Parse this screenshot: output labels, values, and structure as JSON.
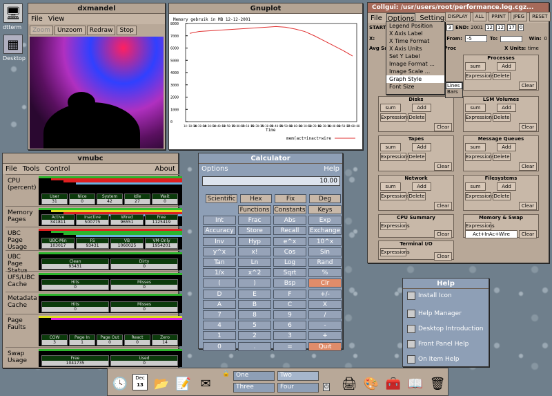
{
  "desktop": {
    "icon1": "dtterm",
    "icon2": "Desktop"
  },
  "dxmandel": {
    "title": "dxmandel",
    "menu": [
      "File",
      "View"
    ],
    "buttons": [
      "Zoom",
      "Unzoom",
      "Redraw",
      "Stop"
    ]
  },
  "gnuplot": {
    "title": "Gnuplot",
    "plot_title": "Memory gebruik in MB 12-12-2001",
    "xlabel": "Time",
    "legend": "mem(act+inact+wire"
  },
  "chart_data": {
    "type": "line",
    "title": "Memory gebruik in MB 12-12-2001",
    "xlabel": "Time",
    "ylabel": "",
    "ylim": [
      0,
      8000
    ],
    "yticks": [
      "0",
      "1000",
      "2000",
      "3000",
      "4000",
      "5000",
      "6000",
      "7000",
      "8000"
    ],
    "categories": [
      "14:10:00",
      "14:20:00",
      "14:30:00",
      "14:40:00",
      "14:50:00",
      "15:00:00",
      "15:10:00",
      "15:20:00",
      "15:30:00",
      "15:40:00",
      "15:50:00",
      "16:00:00",
      "16:10:00",
      "16:20:00",
      "16:30:00",
      "16:40:00",
      "16:50:00",
      "17:00:00"
    ],
    "series": [
      {
        "name": "mem(act+inact+wire",
        "values": [
          7200,
          7350,
          7400,
          7450,
          7500,
          7550,
          7600,
          7650,
          7700,
          7750,
          7700,
          7550,
          7350,
          7000,
          6600,
          6200,
          5800,
          5350
        ]
      }
    ]
  },
  "vmubc": {
    "title": "vmubc",
    "menu": [
      "File",
      "Tools",
      "Control"
    ],
    "about": "About",
    "rows": [
      {
        "label": "CPU (percent)",
        "boxes": [
          [
            "User",
            "31"
          ],
          [
            "Nice",
            "0"
          ],
          [
            "System",
            "42"
          ],
          [
            "Idle",
            "27"
          ],
          [
            "Wait",
            "0"
          ]
        ]
      },
      {
        "label": "Memory Pages",
        "boxes": [
          [
            "Active",
            "341811"
          ],
          [
            "Inactive",
            "500775"
          ],
          [
            "Wired",
            "96551"
          ],
          [
            "Free",
            "1125419"
          ]
        ]
      },
      {
        "label": "UBC Page Usage",
        "boxes": [
          [
            "UBC-Min",
            "103017"
          ],
          [
            "FS",
            "93431"
          ],
          [
            "VB",
            "1060025"
          ],
          [
            "VM-Only",
            "1954201"
          ]
        ]
      },
      {
        "label": "UBC Page Status",
        "boxes": [
          [
            "Clean",
            "93431"
          ],
          [
            "Dirty",
            "0"
          ]
        ]
      },
      {
        "label": "UFS/UBC Cache",
        "boxes": [
          [
            "Hits",
            "0"
          ],
          [
            "Misses",
            "0"
          ]
        ]
      },
      {
        "label": "Metadata Cache",
        "boxes": [
          [
            "Hits",
            "0"
          ],
          [
            "Misses",
            "0"
          ]
        ]
      },
      {
        "label": "Page Faults",
        "boxes": [
          [
            "COW",
            "3"
          ],
          [
            "Page In",
            "1"
          ],
          [
            "Page Out",
            "0"
          ],
          [
            "React",
            "0"
          ],
          [
            "Zero",
            "14"
          ]
        ]
      },
      {
        "label": "Swap Usage",
        "boxes": [
          [
            "Free",
            "1041735"
          ],
          [
            "Used",
            "0"
          ]
        ]
      }
    ]
  },
  "calculator": {
    "title": "Calculator",
    "menu_left": "Options",
    "menu_right": "Help",
    "display": "10.00",
    "modes": [
      "Scientific",
      "Hex",
      "Fix",
      "Deg"
    ],
    "keys": [
      [
        "",
        "Functions",
        "Constants",
        "Keys"
      ],
      [
        "Int",
        "Frac",
        "Abs",
        "Exp"
      ],
      [
        "Accuracy",
        "Store",
        "Recall",
        "Exchange"
      ],
      [
        "Inv",
        "Hyp",
        "e^x",
        "10^x"
      ],
      [
        "y^x",
        "x!",
        "Cos",
        "Sin"
      ],
      [
        "Tan",
        "Ln",
        "Log",
        "Rand"
      ],
      [
        "1/x",
        "x^2",
        "Sqrt",
        "%"
      ],
      [
        "(",
        ")",
        "Bsp",
        "Clr"
      ],
      [
        "D",
        "E",
        "F",
        "+/-"
      ],
      [
        "A",
        "B",
        "C",
        "X"
      ],
      [
        "7",
        "8",
        "9",
        "/"
      ],
      [
        "4",
        "5",
        "6",
        "-"
      ],
      [
        "1",
        "2",
        "3",
        "+"
      ],
      [
        "0",
        ".",
        "=",
        "Quit"
      ]
    ]
  },
  "collgui": {
    "title": "Collgui: /usr/users/root/performance.log.cgz...",
    "menu": [
      "File",
      "Options",
      "Settings"
    ],
    "top_buttons": [
      "DISPLAY",
      "ALL",
      "PRINT",
      "JPEG",
      "RESET"
    ],
    "start_label": "START",
    "start_val": "3",
    "end_label": "END:",
    "end_vals": [
      "2001",
      "12",
      "12",
      "17",
      "0"
    ],
    "x_label": "X:",
    "from_label": "From:",
    "from_val": "-5",
    "to_label": "To:",
    "win_label": "Win:",
    "win_val": "0",
    "avg_label": "Avg Sa",
    "avg_right": "/Proc",
    "xunits_label": "X Units:",
    "xunits_val": "time",
    "options_menu": [
      "Legend Position",
      "X Axis Label",
      "X Time Format",
      "X Axis Units",
      "Set Y Label",
      "Image Format ...",
      "Image Scale ...",
      "Graph Style",
      "Font Size"
    ],
    "submenu": [
      "Lines",
      "Bars"
    ],
    "panels": [
      "Processes",
      "Disks",
      "LSM Volumes",
      "Tapes",
      "Message Queues",
      "Network",
      "Filesystems",
      "CPU Summary",
      "Memory & Swap",
      "Terminal I/O"
    ],
    "sum": "sum",
    "add": "Add",
    "expressions": "Expressions",
    "delete": "Delete",
    "clear": "Clear",
    "memory_expr": "Act+InAc+Wire"
  },
  "help": {
    "title": "Help",
    "items": [
      "Install Icon",
      "Help Manager",
      "Desktop Introduction",
      "Front Panel Help",
      "On Item Help"
    ]
  },
  "panel": {
    "date_month": "Dec",
    "date_day": "13",
    "workspaces": [
      "One",
      "Two",
      "Three",
      "Four"
    ]
  }
}
